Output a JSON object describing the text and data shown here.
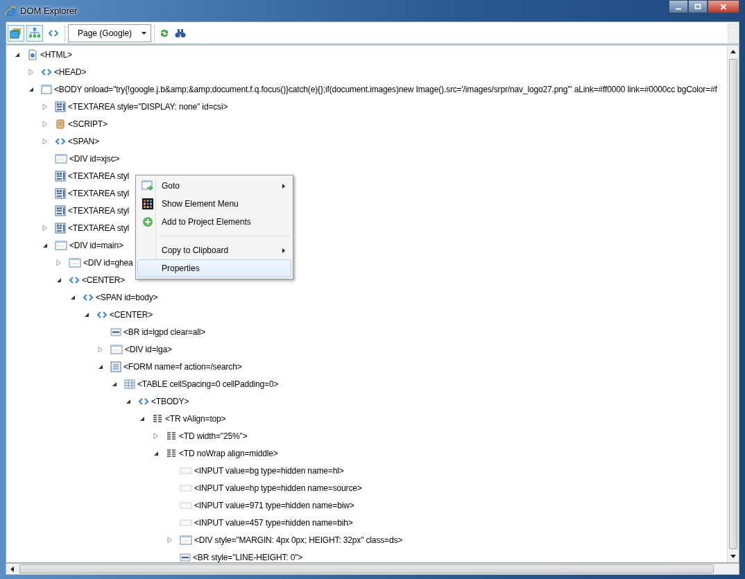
{
  "window": {
    "title": "DOM Explorer"
  },
  "toolbar": {
    "buttons": [
      {
        "kind": "frames",
        "on": true
      },
      {
        "kind": "tree",
        "on": true
      },
      {
        "kind": "tag",
        "on": false
      }
    ],
    "dropdown": {
      "value": "Page (Google)"
    },
    "actions": [
      {
        "kind": "refresh"
      },
      {
        "kind": "find"
      }
    ]
  },
  "tree": [
    {
      "text": "<HTML>",
      "kind": "document",
      "expandable": true,
      "expanded": true,
      "children": [
        {
          "text": "<HEAD>",
          "kind": "tag",
          "expandable": true,
          "expanded": false
        },
        {
          "text": "<BODY onload=\"try{!google.j.b&amp;&amp;document.f.q.focus()}catch(e){};if(document.images)new Image().src='/images/srpr/nav_logo27.png'\" aLink=#ff0000 link=#0000cc bgColor=#f",
          "kind": "body",
          "expandable": true,
          "expanded": true,
          "children": [
            {
              "text": "<TEXTAREA style=\"DISPLAY: none\" id=csi>",
              "kind": "textarea",
              "expandable": true,
              "expanded": false
            },
            {
              "text": "<SCRIPT>",
              "kind": "script",
              "expandable": true,
              "expanded": false
            },
            {
              "text": "<SPAN>",
              "kind": "tag",
              "expandable": true,
              "expanded": false
            },
            {
              "text": "<DIV id=xjsc>",
              "kind": "div",
              "expandable": false
            },
            {
              "text": "<TEXTAREA styl",
              "kind": "textarea",
              "expandable": false
            },
            {
              "text": "<TEXTAREA styl",
              "kind": "textarea",
              "expandable": false
            },
            {
              "text": "<TEXTAREA styl",
              "kind": "textarea",
              "expandable": false
            },
            {
              "text": "<TEXTAREA styl",
              "kind": "textarea",
              "expandable": true,
              "expanded": false
            },
            {
              "text": "<DIV id=main>",
              "kind": "div",
              "expandable": true,
              "expanded": true,
              "children": [
                {
                  "text": "<DIV id=ghea",
                  "kind": "div",
                  "expandable": true,
                  "expanded": false
                },
                {
                  "text": "<CENTER>",
                  "kind": "tag",
                  "expandable": true,
                  "expanded": true,
                  "children": [
                    {
                      "text": "<SPAN id=body>",
                      "kind": "tag",
                      "expandable": true,
                      "expanded": true,
                      "children": [
                        {
                          "text": "<CENTER>",
                          "kind": "tag",
                          "expandable": true,
                          "expanded": true,
                          "children": [
                            {
                              "text": "<BR id=lgpd clear=all>",
                              "kind": "br",
                              "expandable": false
                            },
                            {
                              "text": "<DIV id=lga>",
                              "kind": "div",
                              "expandable": true,
                              "expanded": false
                            },
                            {
                              "text": "<FORM name=f action=/search>",
                              "kind": "form",
                              "expandable": true,
                              "expanded": true,
                              "children": [
                                {
                                  "text": "<TABLE cellSpacing=0 cellPadding=0>",
                                  "kind": "table",
                                  "expandable": true,
                                  "expanded": true,
                                  "children": [
                                    {
                                      "text": "<TBODY>",
                                      "kind": "tag",
                                      "expandable": true,
                                      "expanded": true,
                                      "children": [
                                        {
                                          "text": "<TR vAlign=top>",
                                          "kind": "row",
                                          "expandable": true,
                                          "expanded": true,
                                          "children": [
                                            {
                                              "text": "<TD width=\"25%\">",
                                              "kind": "row",
                                              "expandable": true,
                                              "expanded": false
                                            },
                                            {
                                              "text": "<TD noWrap align=middle>",
                                              "kind": "row",
                                              "expandable": true,
                                              "expanded": true,
                                              "children": [
                                                {
                                                  "text": "<INPUT value=bg type=hidden name=hl>",
                                                  "kind": "input",
                                                  "expandable": false
                                                },
                                                {
                                                  "text": "<INPUT value=hp type=hidden name=source>",
                                                  "kind": "input",
                                                  "expandable": false
                                                },
                                                {
                                                  "text": "<INPUT value=971 type=hidden name=biw>",
                                                  "kind": "input",
                                                  "expandable": false
                                                },
                                                {
                                                  "text": "<INPUT value=457 type=hidden name=bih>",
                                                  "kind": "input",
                                                  "expandable": false
                                                },
                                                {
                                                  "text": "<DIV style=\"MARGIN: 4px 0px; HEIGHT: 32px\" class=ds>",
                                                  "kind": "div",
                                                  "expandable": true,
                                                  "expanded": false
                                                },
                                                {
                                                  "text": "<BR style=\"LINE-HEIGHT: 0\">",
                                                  "kind": "br",
                                                  "expandable": false
                                                }
                                              ]
                                            }
                                          ]
                                        }
                                      ]
                                    }
                                  ]
                                }
                              ]
                            }
                          ]
                        }
                      ]
                    }
                  ]
                }
              ]
            }
          ]
        }
      ]
    }
  ],
  "context_menu": {
    "items": [
      {
        "kind": "goto",
        "label": "Goto",
        "submenu": true,
        "selected": false
      },
      {
        "kind": "grid",
        "label": "Show Element Menu",
        "submenu": false,
        "selected": false
      },
      {
        "kind": "add",
        "label": "Add to Project Elements",
        "submenu": false,
        "selected": false
      },
      {
        "kind": "separator"
      },
      {
        "kind": "plain",
        "label": "Copy to Clipboard",
        "submenu": true,
        "selected": false
      },
      {
        "kind": "plain",
        "label": "Properties",
        "submenu": false,
        "selected": true
      }
    ]
  }
}
